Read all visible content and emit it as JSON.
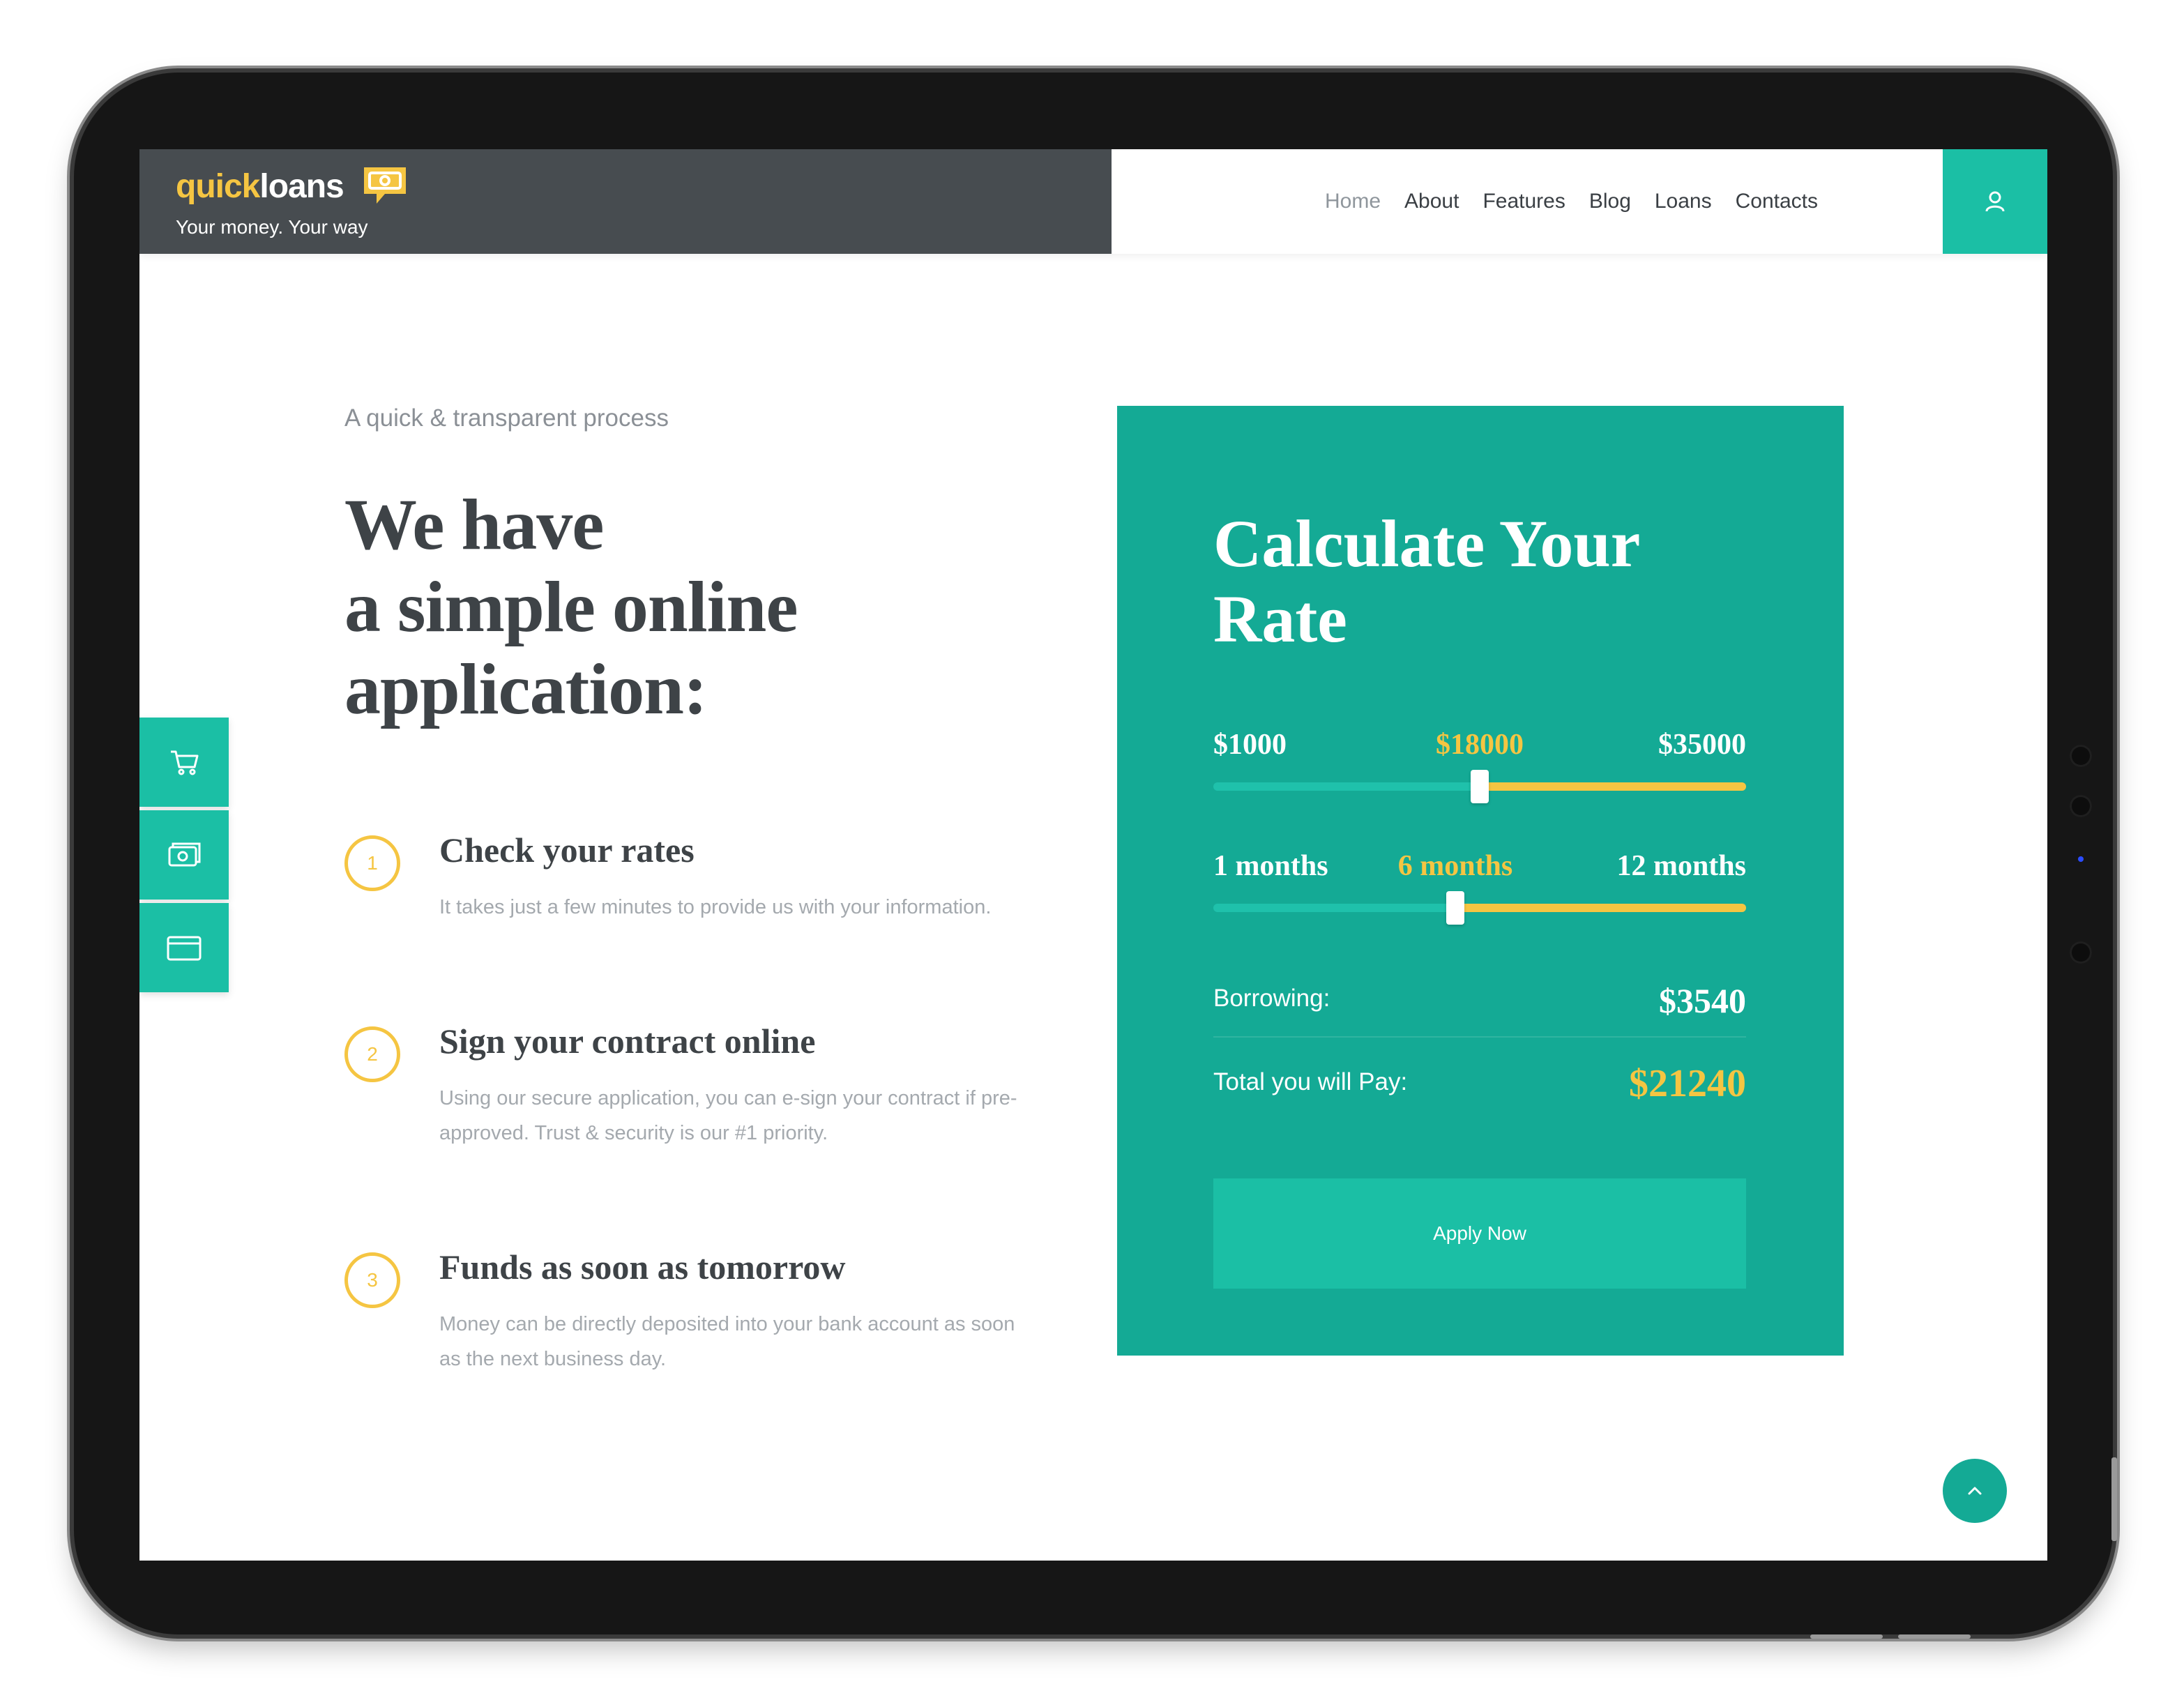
{
  "brand": {
    "name_part1": "quick",
    "name_part2": "loans",
    "tagline": "Your money. Your way",
    "logo_icon": "money-eye-icon",
    "colors": {
      "header_bg": "#474c50",
      "accent": "#1bbfa5",
      "accent_dark": "#14aa95",
      "highlight": "#f5c542"
    }
  },
  "nav": {
    "items": [
      {
        "label": "Home",
        "active": true
      },
      {
        "label": "About",
        "active": false
      },
      {
        "label": "Features",
        "active": false
      },
      {
        "label": "Blog",
        "active": false
      },
      {
        "label": "Loans",
        "active": false
      },
      {
        "label": "Contacts",
        "active": false
      }
    ],
    "user_icon": "user-icon"
  },
  "hero": {
    "kicker": "A quick & transparent process",
    "title_lines": [
      "We have",
      "a simple online",
      "application:"
    ]
  },
  "steps": [
    {
      "number": "1",
      "title": "Check your rates",
      "description": "It takes just a few minutes to provide us with your information."
    },
    {
      "number": "2",
      "title": "Sign your contract online",
      "description": "Using our secure application, you can e-sign your contract if pre-approved. Trust & security is our #1 priority."
    },
    {
      "number": "3",
      "title": "Funds as soon as tomorrow",
      "description": "Money can be directly deposited into your bank account as soon as the next business day."
    }
  ],
  "side_tabs": [
    {
      "icon": "cart-icon"
    },
    {
      "icon": "money-icon"
    },
    {
      "icon": "card-icon"
    }
  ],
  "calculator": {
    "title_lines": [
      "Calculate Your",
      "Rate"
    ],
    "amount": {
      "min_label": "$1000",
      "current_label": "$18000",
      "max_label": "$35000",
      "min": 1000,
      "max": 35000,
      "value": 18000
    },
    "term": {
      "min_label": "1 months",
      "current_label": "6 months",
      "max_label": "12 months",
      "min": 1,
      "max": 12,
      "value": 6
    },
    "borrowing_label": "Borrowing:",
    "borrowing_value": "$3540",
    "total_label": "Total you will Pay:",
    "total_value": "$21240",
    "apply_label": "Apply Now"
  },
  "scroll_top_icon": "chevron-up-icon"
}
